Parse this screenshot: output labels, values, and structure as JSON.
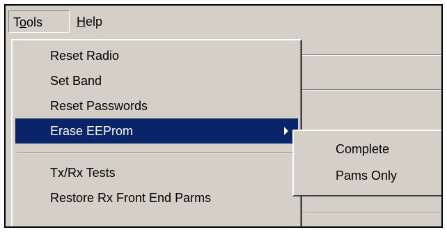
{
  "menubar": {
    "tools_prefix": "T",
    "tools_underline": "o",
    "tools_rest": "ols",
    "help_underline": "H",
    "help_rest": "elp"
  },
  "tools_menu": {
    "items": [
      {
        "label": "Reset Radio"
      },
      {
        "label": "Set Band"
      },
      {
        "label": "Reset Passwords"
      },
      {
        "label": "Erase EEProm",
        "highlighted": true,
        "has_submenu": true
      },
      {
        "label": "Tx/Rx Tests"
      },
      {
        "label": "Restore Rx Front End Parms"
      }
    ]
  },
  "submenu": {
    "items": [
      {
        "label": "Complete"
      },
      {
        "label": "Pams Only"
      }
    ]
  },
  "colors": {
    "highlight": "#0a246a",
    "face": "#d4d0c8"
  }
}
